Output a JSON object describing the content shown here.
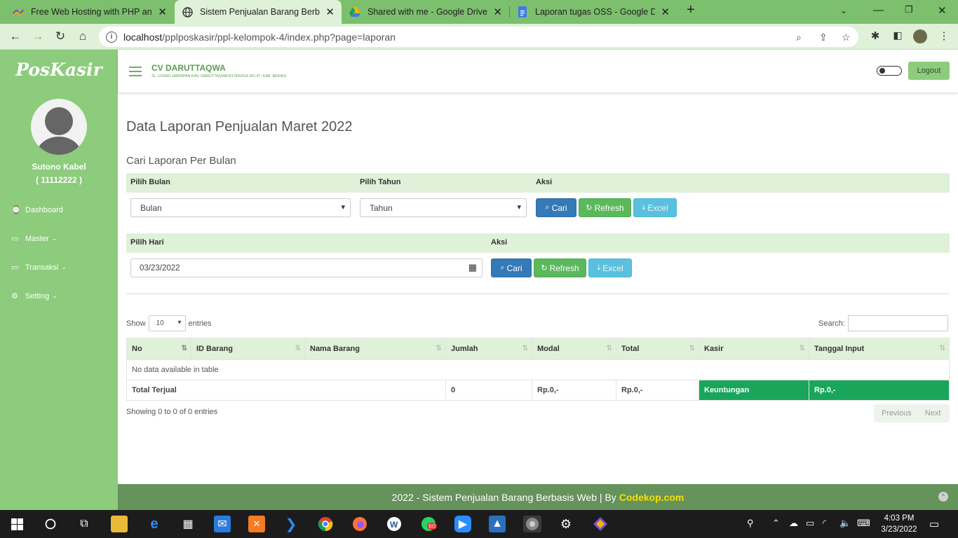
{
  "browser": {
    "tabs": [
      {
        "title": "Free Web Hosting with PHP and",
        "active": false
      },
      {
        "title": "Sistem Penjualan Barang Berbasis",
        "active": true
      },
      {
        "title": "Shared with me - Google Drive",
        "active": false
      },
      {
        "title": "Laporan tugas OSS - Google Doc",
        "active": false
      }
    ],
    "url_host": "localhost",
    "url_path": "/pplposkasir/ppl-kelompok-4/index.php?page=laporan"
  },
  "sidebar": {
    "logo": "PosKasir",
    "user_name": "Sutono Kabel",
    "user_id": "( 11112222 )",
    "items": [
      {
        "label": "Dashboard",
        "icon": "dashboard-icon"
      },
      {
        "label": "Master",
        "icon": "desktop-icon"
      },
      {
        "label": "Transaksi",
        "icon": "desktop-icon"
      },
      {
        "label": "Setting",
        "icon": "gear-icon"
      }
    ]
  },
  "header": {
    "company": "CV DARUTTAQWA",
    "address": "JL. UJUNG HARAPAN KAV. DARUTTAQWA RT.005/014 NO.47, KAB. BEKASI",
    "logout": "Logout"
  },
  "main": {
    "title": "Data Laporan Penjualan Maret 2022",
    "subtitle": "Cari Laporan Per Bulan",
    "monthly": {
      "label_month": "Pilih Bulan",
      "label_year": "Pilih Tahun",
      "label_action": "Aksi",
      "month_value": "Bulan",
      "year_value": "Tahun"
    },
    "daily": {
      "label_day": "Pilih Hari",
      "label_action": "Aksi",
      "date_value": "03/23/2022"
    },
    "buttons": {
      "search": "Cari",
      "refresh": "Refresh",
      "excel": "Excel"
    }
  },
  "table": {
    "show": "Show",
    "entries_value": "10",
    "entries": "entries",
    "search_label": "Search:",
    "columns": [
      "No",
      "ID Barang",
      "Nama Barang",
      "Jumlah",
      "Modal",
      "Total",
      "Kasir",
      "Tanggal Input"
    ],
    "empty": "No data available in table",
    "footer": {
      "label": "Total Terjual",
      "jumlah": "0",
      "modal": "Rp.0,-",
      "total": "Rp.0,-",
      "keuntungan_label": "Keuntungan",
      "keuntungan_value": "Rp.0,-"
    },
    "info": "Showing 0 to 0 of 0 entries",
    "prev": "Previous",
    "next": "Next"
  },
  "footer": {
    "text": "2022 - Sistem Penjualan Barang Berbasis Web | By",
    "brand": "Codekop.com"
  },
  "taskbar": {
    "time": "4:03 PM",
    "date": "3/23/2022",
    "whatsapp_badge": "60"
  },
  "colors": {
    "sidebar": "#8ccc7c",
    "accent_band": "#dff1d9",
    "footer": "#65935b",
    "profit": "#19a65b"
  }
}
